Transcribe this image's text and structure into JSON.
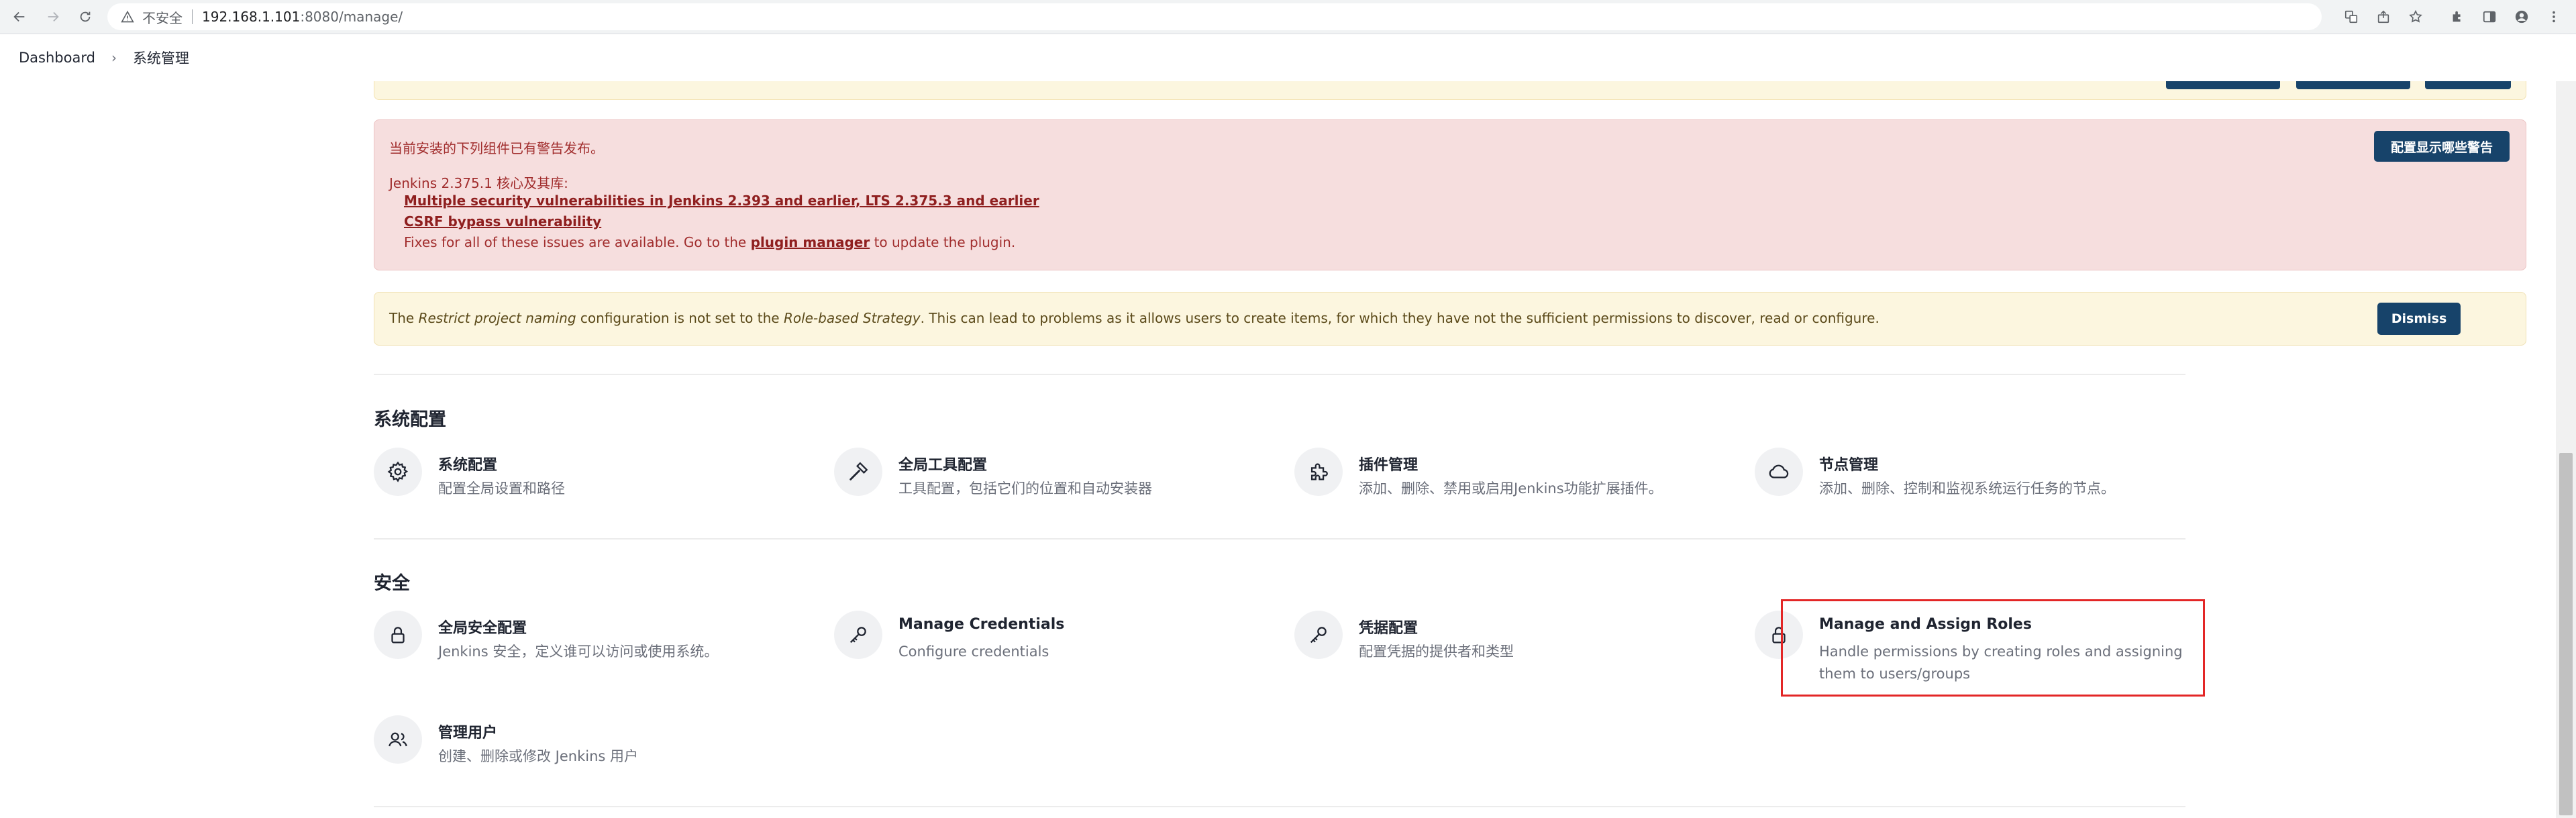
{
  "browser": {
    "insecure_label": "不安全",
    "url_host": "192.168.1.101",
    "url_path": ":8080/manage/"
  },
  "breadcrumb": {
    "items": [
      "Dashboard",
      "系统管理"
    ]
  },
  "security_alert": {
    "heading": "当前安装的下列组件已有警告发布。",
    "component": "Jenkins 2.375.1 核心及其库:",
    "links": [
      "Multiple security vulnerabilities in Jenkins 2.393 and earlier, LTS 2.375.3 and earlier",
      "CSRF bypass vulnerability"
    ],
    "fix_prefix": "Fixes for all of these issues are available. Go to the",
    "fix_link": "plugin manager",
    "fix_suffix": "to update the plugin.",
    "button_label": "配置显示哪些警告"
  },
  "restrict_alert": {
    "part1": "The",
    "em1": "Restrict project naming",
    "part2": "configuration is not set to the",
    "em2": "Role-based Strategy",
    "part3": ". This can lead to problems as it allows users to create items, for which they have not the sufficient permissions to discover, read or configure.",
    "button_label": "Dismiss"
  },
  "sections": [
    {
      "title": "系统配置",
      "items": [
        {
          "title": "系统配置",
          "desc": "配置全局设置和路径",
          "icon": "gear-icon"
        },
        {
          "title": "全局工具配置",
          "desc": "工具配置，包括它们的位置和自动安装器",
          "icon": "hammer-icon"
        },
        {
          "title": "插件管理",
          "desc": "添加、删除、禁用或启用Jenkins功能扩展插件。",
          "icon": "puzzle-icon"
        },
        {
          "title": "节点管理",
          "desc": "添加、删除、控制和监视系统运行任务的节点。",
          "icon": "cloud-icon"
        }
      ]
    },
    {
      "title": "安全",
      "items": [
        {
          "title": "全局安全配置",
          "desc": "Jenkins 安全，定义谁可以访问或使用系统。",
          "icon": "lock-icon"
        },
        {
          "title": "Manage Credentials",
          "desc": "Configure credentials",
          "icon": "key-icon"
        },
        {
          "title": "凭据配置",
          "desc": "配置凭据的提供者和类型",
          "icon": "key-icon"
        },
        {
          "title": "Manage and Assign Roles",
          "desc": "Handle permissions by creating roles and assigning them to users/groups",
          "icon": "lock-icon"
        },
        {
          "title": "管理用户",
          "desc": "创建、删除或修改 Jenkins 用户",
          "icon": "users-icon"
        }
      ]
    }
  ]
}
